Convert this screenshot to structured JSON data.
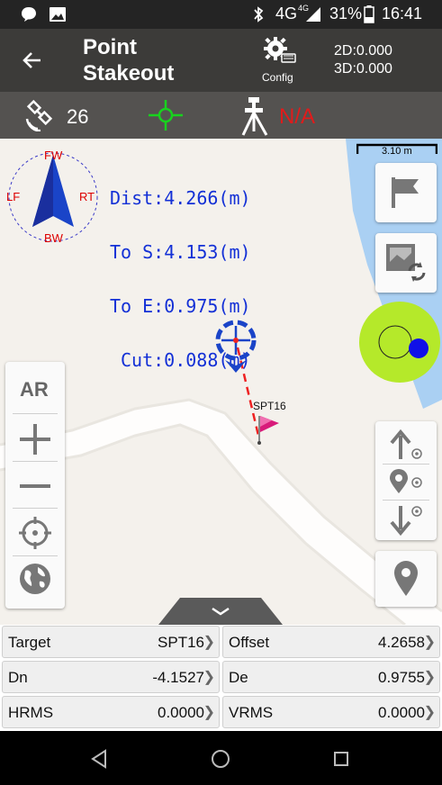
{
  "status_bar": {
    "network": "4G",
    "network_small": "4G",
    "battery": "31%",
    "time": "16:41"
  },
  "header": {
    "title_line1": "Point",
    "title_line2": "Stakeout",
    "config_label": "Config",
    "dim2d": "2D:0.000",
    "dim3d": "3D:0.000"
  },
  "subbar": {
    "satellites": "26",
    "base_status": "N/A"
  },
  "compass": {
    "fw": "FW",
    "bw": "BW",
    "lf": "LF",
    "rt": "RT"
  },
  "nav": {
    "dist": "Dist:4.266(m)",
    "to_s": "To S:4.153(m)",
    "to_e": "To E:0.975(m)",
    "cut": "Cut:0.088(m)"
  },
  "map": {
    "scale": "3.10 m",
    "point_label": "SPT16"
  },
  "zoom_tools": {
    "ar": "AR"
  },
  "info": [
    {
      "label": "Target",
      "value": "SPT16"
    },
    {
      "label": "Offset",
      "value": "4.2658"
    },
    {
      "label": "Dn",
      "value": "-4.1527"
    },
    {
      "label": "De",
      "value": "0.9755"
    },
    {
      "label": "HRMS",
      "value": "0.0000"
    },
    {
      "label": "VRMS",
      "value": "0.0000"
    }
  ],
  "colors": {
    "header_bg": "#3c3b39",
    "subbar_bg": "#545250",
    "accent_green": "#18d21e",
    "alert_red": "#e11b1b",
    "nav_blue": "#1330d6",
    "bubble_green": "#b5e92a"
  }
}
